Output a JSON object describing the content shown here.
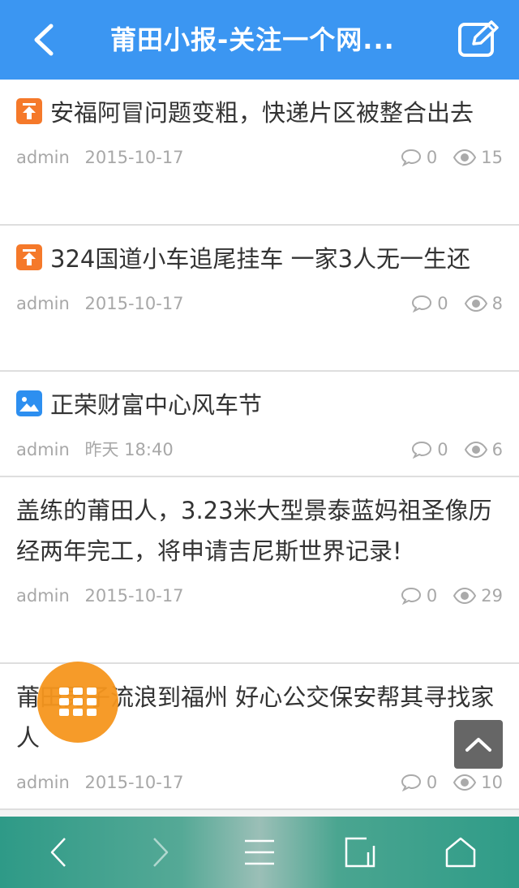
{
  "header": {
    "title": "莆田小报-关注一个网...",
    "back_icon": "chevron-left-icon",
    "edit_icon": "edit-icon"
  },
  "articles": [
    {
      "tag": "top",
      "title": "安福阿冒问题变粗，快递片区被整合出去",
      "author": "admin",
      "date": "2015-10-17",
      "comments": "0",
      "views": "15"
    },
    {
      "tag": "top",
      "title": "324国道小车追尾挂车 一家3人无一生还",
      "author": "admin",
      "date": "2015-10-17",
      "comments": "0",
      "views": "8"
    },
    {
      "tag": "image",
      "title": "正荣财富中心风车节",
      "author": "admin",
      "date": "昨天 18:40",
      "comments": "0",
      "views": "6"
    },
    {
      "tag": "",
      "title": "盖练的莆田人，3.23米大型景泰蓝妈祖圣像历经两年完工，将申请吉尼斯世界记录!",
      "author": "admin",
      "date": "2015-10-17",
      "comments": "0",
      "views": "29"
    },
    {
      "tag": "",
      "title": "莆田男子流浪到福州 好心公交保安帮其寻找家人",
      "author": "admin",
      "date": "2015-10-17",
      "comments": "0",
      "views": "10"
    }
  ],
  "colors": {
    "header": "#3b96f2",
    "tag_top": "#f5792a",
    "tag_image": "#2d8ff0",
    "fab": "#f5961e",
    "bottom_bar": "#2e9a87"
  }
}
